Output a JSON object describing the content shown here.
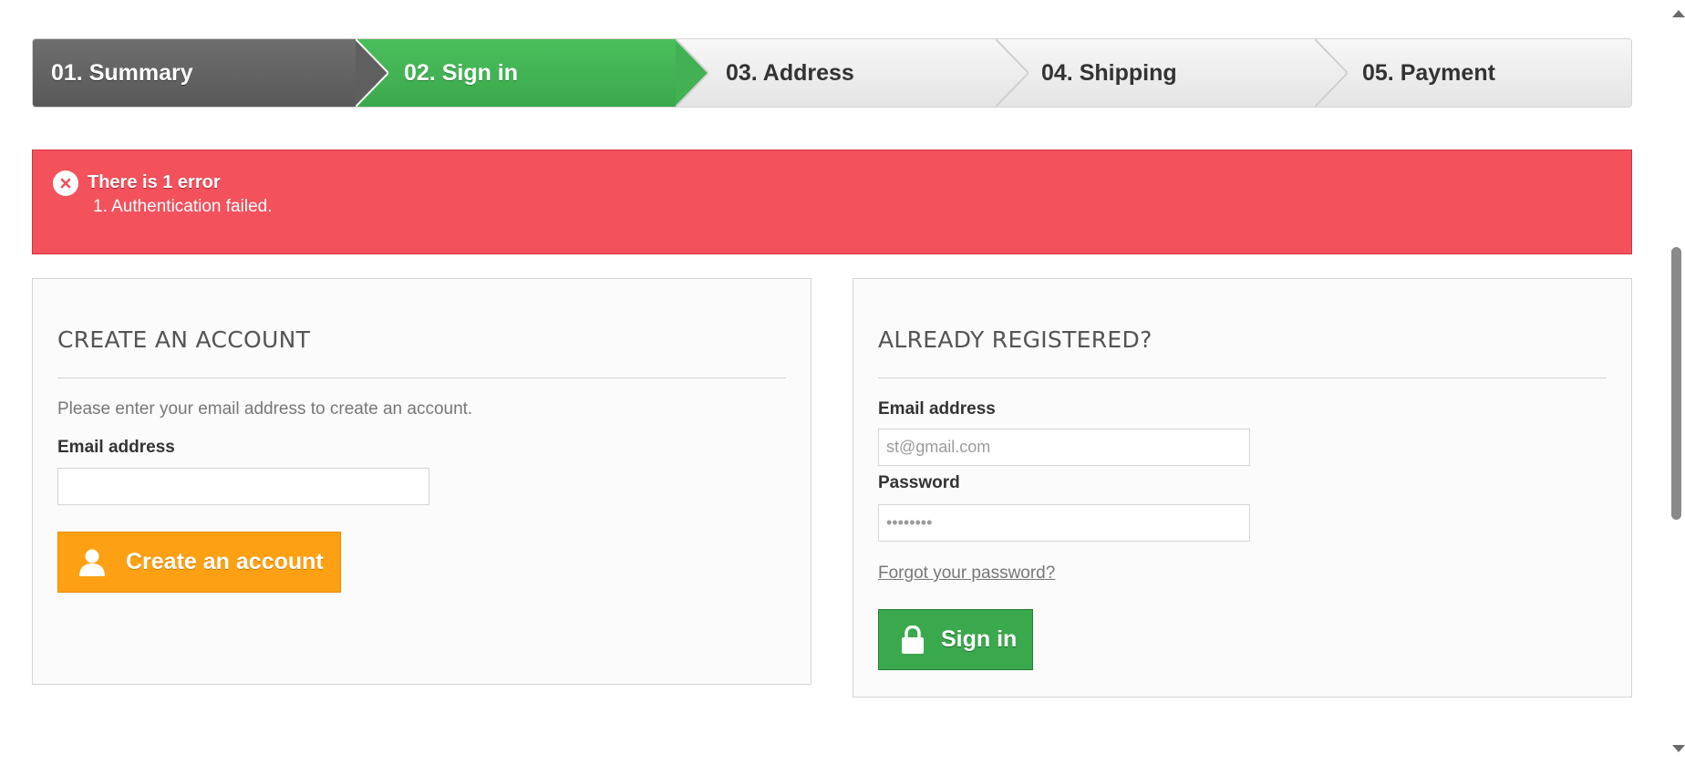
{
  "steps": [
    {
      "label": "01. Summary",
      "state": "done"
    },
    {
      "label": "02. Sign in",
      "state": "current"
    },
    {
      "label": "03. Address",
      "state": "todo"
    },
    {
      "label": "04. Shipping",
      "state": "todo"
    },
    {
      "label": "05. Payment",
      "state": "todo"
    }
  ],
  "alert": {
    "icon": "close-circle-icon",
    "title": "There is 1 error",
    "errors": [
      "1. Authentication failed."
    ],
    "color": "#f3515c"
  },
  "create_account": {
    "heading": "CREATE AN ACCOUNT",
    "intro": "Please enter your email address to create an account.",
    "email_label": "Email address",
    "email_value": "",
    "button_label": "Create an account",
    "button_icon": "user-icon",
    "button_color": "#fda014"
  },
  "login": {
    "heading": "ALREADY REGISTERED?",
    "email_label": "Email address",
    "email_value": "st@gmail.com",
    "password_label": "Password",
    "password_value": "••••••••",
    "forgot_label": "Forgot your password?",
    "button_label": "Sign in",
    "button_icon": "lock-icon",
    "button_color": "#3aa84c"
  }
}
